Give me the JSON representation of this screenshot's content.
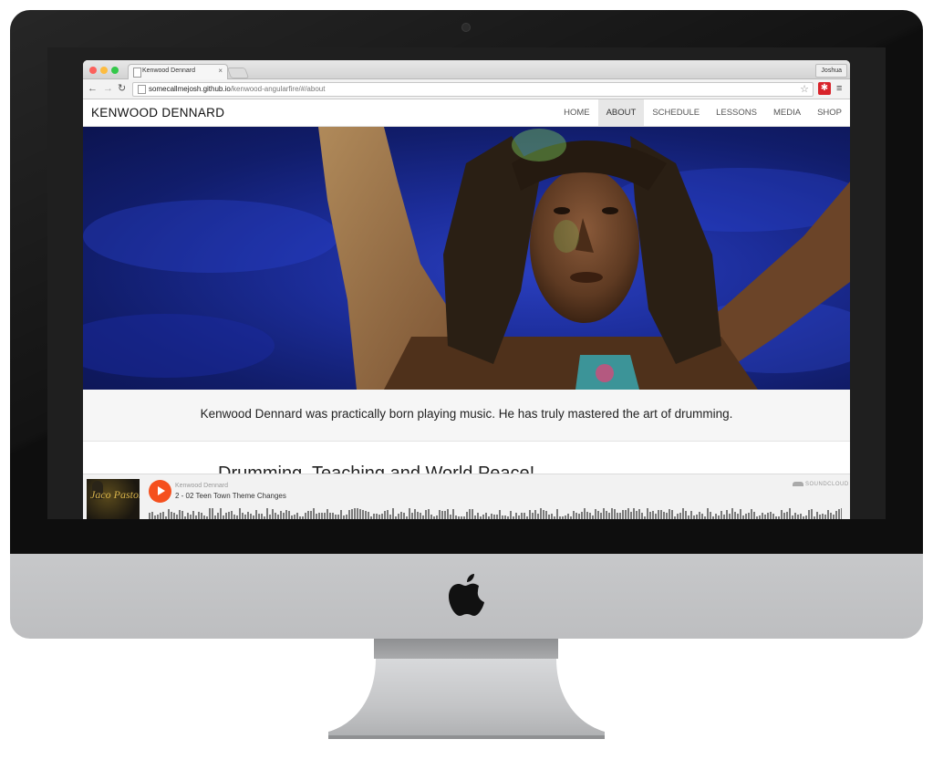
{
  "browser": {
    "tab_title": "Kenwood Dennard",
    "tab_close": "×",
    "profile_name": "Joshua",
    "url_host": "somecallmejosh.github.io",
    "url_path": "/kenwood-angularfire/#/about",
    "back_icon": "←",
    "forward_icon": "→",
    "reload_icon": "↻",
    "star_icon": "☆",
    "menu_icon": "≡",
    "traffic_light_colors": [
      "#fc605c",
      "#fdbc40",
      "#34c84a"
    ]
  },
  "site": {
    "brand": "KENWOOD DENNARD",
    "nav": {
      "items": [
        {
          "label": "HOME",
          "active": false
        },
        {
          "label": "ABOUT",
          "active": true
        },
        {
          "label": "SCHEDULE",
          "active": false
        },
        {
          "label": "LESSONS",
          "active": false
        },
        {
          "label": "MEDIA",
          "active": false
        },
        {
          "label": "SHOP",
          "active": false
        }
      ]
    },
    "tagline": "Kenwood Dennard was practically born playing music. He has truly mastered the art of drumming.",
    "section_heading": "Drumming, Teaching and World Peace!"
  },
  "player": {
    "artist": "Kenwood Dennard",
    "track_title": "2 - 02 Teen Town Theme Changes",
    "brand": "SOUNDCLOUD",
    "accent_color": "#f5501e",
    "artwork_text": "Jaco Pastorius"
  }
}
